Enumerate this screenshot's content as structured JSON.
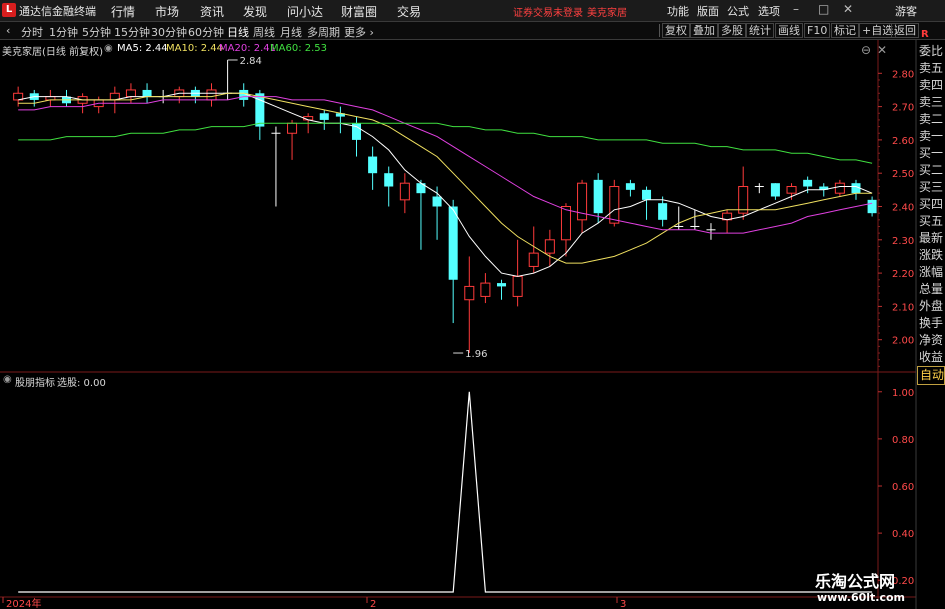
{
  "app": {
    "logo": "L",
    "title": "通达信金融终端"
  },
  "menu": [
    "行情",
    "市场",
    "资讯",
    "发现",
    "问小达",
    "财富圈",
    "交易"
  ],
  "alert": [
    "证券交易未登录",
    "美克家居"
  ],
  "right_menu": [
    "功能",
    "版面",
    "公式",
    "选项",
    "游客"
  ],
  "window_controls": [
    "–",
    "□",
    "✕"
  ],
  "periods": [
    "分时",
    "1分钟",
    "5分钟",
    "15分钟",
    "30分钟",
    "60分钟",
    "日线",
    "周线",
    "月线",
    "多周期",
    "更多 ›"
  ],
  "active_period": "日线",
  "toolbar_right": [
    "复权",
    "叠加",
    "多股",
    "统计",
    "画线",
    "F10",
    "标记",
    "+自选",
    "返回"
  ],
  "main_info": {
    "name": "美克家居(日线 前复权)",
    "ma": [
      {
        "label": "MA5: 2.44",
        "color": "#ffffff"
      },
      {
        "label": "MA10: 2.44",
        "color": "#f0e060"
      },
      {
        "label": "MA20: 2.41",
        "color": "#e040e0"
      },
      {
        "label": "MA60: 2.53",
        "color": "#40e040"
      }
    ]
  },
  "sub_info": {
    "name": "股朋指标",
    "value": "选股: 0.00"
  },
  "marker_r": "R",
  "side_panel": [
    "委比",
    "卖五",
    "卖四",
    "卖三",
    "卖二",
    "卖一",
    "买一",
    "买二",
    "买三",
    "买四",
    "买五",
    "最新",
    "涨跌",
    "涨幅",
    "总量",
    "外盘",
    "换手",
    "净资",
    "收益",
    "自动"
  ],
  "x_labels": [
    "2024年",
    "2",
    "3"
  ],
  "watermark": {
    "title": "乐淘公式网",
    "url": "www.60lt.com"
  },
  "colors": {
    "up": "#ff3b3b",
    "down": "#54ffff",
    "ma5": "#ffffff",
    "ma10": "#f0e060",
    "ma20": "#e040e0",
    "ma60": "#40e040",
    "grid": "#7a1a1a"
  },
  "chart_data": [
    {
      "type": "candlestick",
      "ylim": [
        1.9,
        2.9
      ],
      "yticks": [
        2.8,
        2.7,
        2.6,
        2.5,
        2.4,
        2.3,
        2.2,
        2.1,
        2.0
      ],
      "annotations": [
        {
          "text": "2.84",
          "value": 2.84,
          "index": 13
        },
        {
          "text": "1.96",
          "value": 1.96,
          "index": 27
        }
      ],
      "candles": [
        [
          2.72,
          2.74,
          2.7,
          2.76
        ],
        [
          2.74,
          2.72,
          2.7,
          2.75
        ],
        [
          2.72,
          2.73,
          2.7,
          2.75
        ],
        [
          2.73,
          2.71,
          2.7,
          2.75
        ],
        [
          2.71,
          2.73,
          2.68,
          2.74
        ],
        [
          2.7,
          2.72,
          2.68,
          2.73
        ],
        [
          2.72,
          2.74,
          2.68,
          2.76
        ],
        [
          2.73,
          2.75,
          2.71,
          2.77
        ],
        [
          2.75,
          2.73,
          2.71,
          2.77
        ],
        [
          2.73,
          2.73,
          2.71,
          2.75
        ],
        [
          2.73,
          2.75,
          2.71,
          2.76
        ],
        [
          2.75,
          2.73,
          2.71,
          2.76
        ],
        [
          2.72,
          2.75,
          2.7,
          2.77
        ],
        [
          2.74,
          2.74,
          2.72,
          2.84
        ],
        [
          2.75,
          2.72,
          2.7,
          2.77
        ],
        [
          2.74,
          2.64,
          2.6,
          2.75
        ],
        [
          2.62,
          2.62,
          2.4,
          2.64
        ],
        [
          2.62,
          2.65,
          2.54,
          2.66
        ],
        [
          2.66,
          2.67,
          2.62,
          2.68
        ],
        [
          2.68,
          2.66,
          2.63,
          2.69
        ],
        [
          2.68,
          2.67,
          2.62,
          2.7
        ],
        [
          2.65,
          2.6,
          2.55,
          2.67
        ],
        [
          2.55,
          2.5,
          2.45,
          2.58
        ],
        [
          2.5,
          2.46,
          2.4,
          2.52
        ],
        [
          2.42,
          2.47,
          2.38,
          2.5
        ],
        [
          2.47,
          2.44,
          2.27,
          2.48
        ],
        [
          2.43,
          2.4,
          2.3,
          2.46
        ],
        [
          2.4,
          2.18,
          2.05,
          2.42
        ],
        [
          2.12,
          2.16,
          1.96,
          2.25
        ],
        [
          2.13,
          2.17,
          2.11,
          2.2
        ],
        [
          2.17,
          2.16,
          2.12,
          2.18
        ],
        [
          2.13,
          2.19,
          2.1,
          2.3
        ],
        [
          2.22,
          2.26,
          2.2,
          2.34
        ],
        [
          2.26,
          2.3,
          2.22,
          2.33
        ],
        [
          2.3,
          2.4,
          2.25,
          2.41
        ],
        [
          2.36,
          2.47,
          2.32,
          2.48
        ],
        [
          2.48,
          2.38,
          2.35,
          2.5
        ],
        [
          2.35,
          2.46,
          2.34,
          2.48
        ],
        [
          2.47,
          2.45,
          2.43,
          2.48
        ],
        [
          2.45,
          2.42,
          2.36,
          2.46
        ],
        [
          2.41,
          2.36,
          2.34,
          2.43
        ],
        [
          2.34,
          2.34,
          2.33,
          2.4
        ],
        [
          2.34,
          2.34,
          2.33,
          2.39
        ],
        [
          2.33,
          2.33,
          2.3,
          2.35
        ],
        [
          2.36,
          2.38,
          2.32,
          2.39
        ],
        [
          2.38,
          2.46,
          2.36,
          2.52
        ],
        [
          2.46,
          2.46,
          2.44,
          2.47
        ],
        [
          2.47,
          2.43,
          2.42,
          2.47
        ],
        [
          2.44,
          2.46,
          2.42,
          2.47
        ],
        [
          2.48,
          2.46,
          2.44,
          2.49
        ],
        [
          2.46,
          2.45,
          2.43,
          2.47
        ],
        [
          2.44,
          2.47,
          2.43,
          2.48
        ],
        [
          2.47,
          2.44,
          2.42,
          2.48
        ],
        [
          2.42,
          2.38,
          2.37,
          2.43
        ]
      ],
      "series": [
        {
          "name": "MA5",
          "values": [
            2.72,
            2.73,
            2.73,
            2.73,
            2.72,
            2.72,
            2.72,
            2.73,
            2.73,
            2.73,
            2.74,
            2.74,
            2.74,
            2.74,
            2.74,
            2.72,
            2.7,
            2.68,
            2.66,
            2.65,
            2.65,
            2.64,
            2.61,
            2.57,
            2.51,
            2.47,
            2.44,
            2.39,
            2.31,
            2.25,
            2.2,
            2.19,
            2.2,
            2.22,
            2.26,
            2.32,
            2.35,
            2.39,
            2.4,
            2.42,
            2.42,
            2.41,
            2.39,
            2.37,
            2.36,
            2.37,
            2.39,
            2.41,
            2.43,
            2.45,
            2.45,
            2.46,
            2.46,
            2.44
          ]
        },
        {
          "name": "MA10",
          "values": [
            2.71,
            2.71,
            2.72,
            2.72,
            2.72,
            2.72,
            2.72,
            2.72,
            2.73,
            2.73,
            2.73,
            2.73,
            2.73,
            2.74,
            2.74,
            2.73,
            2.72,
            2.71,
            2.7,
            2.69,
            2.68,
            2.67,
            2.66,
            2.64,
            2.61,
            2.58,
            2.55,
            2.5,
            2.45,
            2.4,
            2.35,
            2.31,
            2.28,
            2.25,
            2.23,
            2.23,
            2.24,
            2.25,
            2.27,
            2.29,
            2.32,
            2.35,
            2.37,
            2.38,
            2.39,
            2.39,
            2.39,
            2.39,
            2.4,
            2.41,
            2.42,
            2.43,
            2.44,
            2.44
          ]
        },
        {
          "name": "MA20",
          "values": [
            2.69,
            2.69,
            2.7,
            2.7,
            2.7,
            2.71,
            2.71,
            2.71,
            2.71,
            2.72,
            2.72,
            2.72,
            2.72,
            2.72,
            2.73,
            2.73,
            2.73,
            2.72,
            2.72,
            2.72,
            2.71,
            2.7,
            2.69,
            2.67,
            2.65,
            2.63,
            2.61,
            2.58,
            2.55,
            2.52,
            2.49,
            2.46,
            2.43,
            2.41,
            2.39,
            2.38,
            2.37,
            2.36,
            2.35,
            2.34,
            2.33,
            2.33,
            2.33,
            2.32,
            2.32,
            2.32,
            2.33,
            2.34,
            2.35,
            2.37,
            2.38,
            2.39,
            2.4,
            2.41
          ]
        },
        {
          "name": "MA60",
          "values": [
            2.6,
            2.6,
            2.6,
            2.61,
            2.61,
            2.61,
            2.61,
            2.62,
            2.62,
            2.62,
            2.63,
            2.63,
            2.64,
            2.64,
            2.64,
            2.65,
            2.65,
            2.65,
            2.65,
            2.65,
            2.65,
            2.65,
            2.65,
            2.65,
            2.65,
            2.65,
            2.65,
            2.64,
            2.64,
            2.63,
            2.63,
            2.62,
            2.62,
            2.61,
            2.61,
            2.61,
            2.6,
            2.6,
            2.6,
            2.6,
            2.59,
            2.59,
            2.59,
            2.58,
            2.58,
            2.57,
            2.57,
            2.57,
            2.56,
            2.56,
            2.55,
            2.54,
            2.54,
            2.53
          ]
        }
      ]
    },
    {
      "type": "line",
      "ylim": [
        0.15,
        1.05
      ],
      "yticks": [
        1.0,
        0.8,
        0.6,
        0.4,
        0.2
      ],
      "series": [
        {
          "name": "选股",
          "values": [
            0,
            0,
            0,
            0,
            0,
            0,
            0,
            0,
            0,
            0,
            0,
            0,
            0,
            0,
            0,
            0,
            0,
            0,
            0,
            0,
            0,
            0,
            0,
            0,
            0,
            0,
            0,
            0,
            1,
            0,
            0,
            0,
            0,
            0,
            0,
            0,
            0,
            0,
            0,
            0,
            0,
            0,
            0,
            0,
            0,
            0,
            0,
            0,
            0,
            0,
            0,
            0,
            0,
            0
          ]
        }
      ]
    }
  ]
}
